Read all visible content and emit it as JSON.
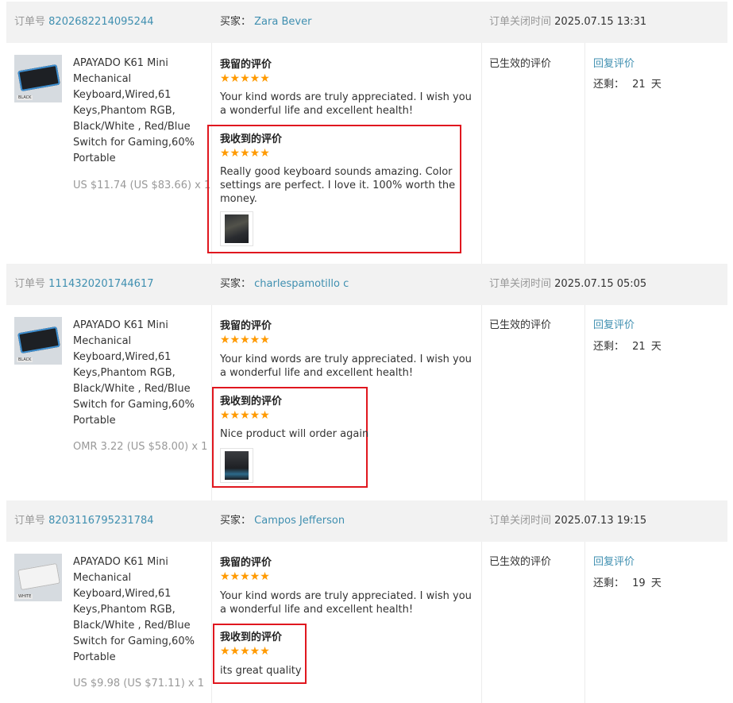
{
  "labels": {
    "order_no": "订单号",
    "buyer": "买家：",
    "close_time": "订单关闭时间",
    "my_review": "我留的评价",
    "received_review": "我收到的评价",
    "status": "已生效的评价",
    "reply": "回复评价",
    "remaining": "还剩：",
    "days_unit": "天"
  },
  "colors": {
    "link": "#3f8fb0",
    "star": "#ff9a00",
    "highlight_box": "#e0171f",
    "header_bg": "#f2f2f2"
  },
  "orders": [
    {
      "order_number": "8202682214095244",
      "buyer_name": "Zara Bever",
      "close_time": "2025.07.15 13:31",
      "product_title": "APAYADO K61 Mini Mechanical Keyboard,Wired,61 Keys,Phantom RGB, Black/White , Red/Blue Switch for Gaming,60% Portable",
      "product_thumb_label": "BLACK",
      "price": "US $11.74 (US $83.66) x 1",
      "my_review_stars": "★★★★★",
      "my_review_rating": 5,
      "my_review_text": "Your kind words are truly appreciated. I wish you a wonderful life and excellent health!",
      "received_review_stars": "★★★★★",
      "received_review_rating": 5,
      "received_review_text": "Really good keyboard sounds amazing. Color settings are perfect. I love it. 100% worth the money.",
      "days_remaining": "21"
    },
    {
      "order_number": "1114320201744617",
      "buyer_name": "charlespamotillo c",
      "close_time": "2025.07.15 05:05",
      "product_title": "APAYADO K61 Mini Mechanical Keyboard,Wired,61 Keys,Phantom RGB, Black/White , Red/Blue Switch for Gaming,60% Portable",
      "product_thumb_label": "BLACK",
      "price": "OMR 3.22 (US $58.00) x 1",
      "my_review_stars": "★★★★★",
      "my_review_rating": 5,
      "my_review_text": "Your kind words are truly appreciated. I wish you a wonderful life and excellent health!",
      "received_review_stars": "★★★★★",
      "received_review_rating": 5,
      "received_review_text": "Nice product will order again",
      "days_remaining": "21"
    },
    {
      "order_number": "8203116795231784",
      "buyer_name": "Campos Jefferson",
      "close_time": "2025.07.13 19:15",
      "product_title": "APAYADO K61 Mini Mechanical Keyboard,Wired,61 Keys,Phantom RGB, Black/White , Red/Blue Switch for Gaming,60% Portable",
      "product_thumb_label": "WHITE",
      "price": "US $9.98 (US $71.11) x 1",
      "my_review_stars": "★★★★★",
      "my_review_rating": 5,
      "my_review_text": "Your kind words are truly appreciated. I wish you a wonderful life and excellent health!",
      "received_review_stars": "★★★★★",
      "received_review_rating": 5,
      "received_review_text": "its great quality",
      "days_remaining": "19"
    }
  ]
}
